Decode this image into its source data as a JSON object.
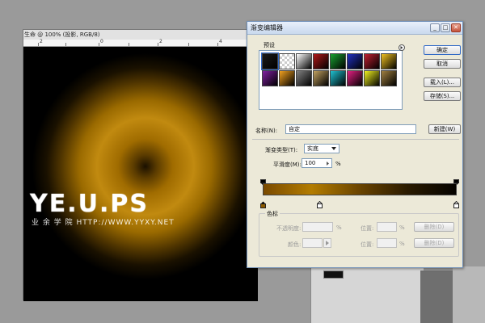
{
  "document": {
    "title": "生命 @ 100% (投影, RGB/8)",
    "ruler_ticks": [
      "2",
      "0",
      "2",
      "4"
    ]
  },
  "watermark": {
    "title": "YE.U.PS",
    "subtitle": "业 余 学 院 HTTP://WWW.YYXY.NET"
  },
  "dialog": {
    "title": "渐变编辑器",
    "window_buttons": [
      "_",
      "□",
      "✕"
    ],
    "presets_label": "预设",
    "buttons": {
      "ok": "确定",
      "cancel": "取消",
      "load": "载入(L)...",
      "save": "存储(S)...",
      "new": "新建(W)"
    },
    "name_label": "名称(N):",
    "name_value": "自定",
    "gradient_type_label": "渐变类型(T):",
    "gradient_type_value": "实底",
    "smoothness_label": "平滑度(M):",
    "smoothness_value": "100",
    "smoothness_unit": "%",
    "color_stops": {
      "group_label": "色标",
      "opacity_label": "不透明度:",
      "opacity_unit": "%",
      "location_label_1": "位置:",
      "location_unit_1": "%",
      "delete_label_1": "删除(D)",
      "color_label": "颜色:",
      "location_label_2": "位置:",
      "location_unit_2": "%",
      "delete_label_2": "删除(D)"
    },
    "preset_swatches": [
      "#1a1a1a",
      "checker",
      "#ffffff",
      "#b01818",
      "#18a030",
      "#2030c0",
      "#c02030",
      "#f0c020",
      "#8020a0",
      "#f0a020",
      "#808080",
      "#c0a060",
      "#20c0d0",
      "#e02080",
      "#f0f020",
      "#a08040"
    ],
    "gradient_colors": [
      "#7a4a00",
      "#b37c00",
      "#6a4400",
      "#2a1a00",
      "#050300"
    ]
  },
  "colors": {
    "accent": "#3169c6",
    "canvas_gold": "#c18a10"
  }
}
